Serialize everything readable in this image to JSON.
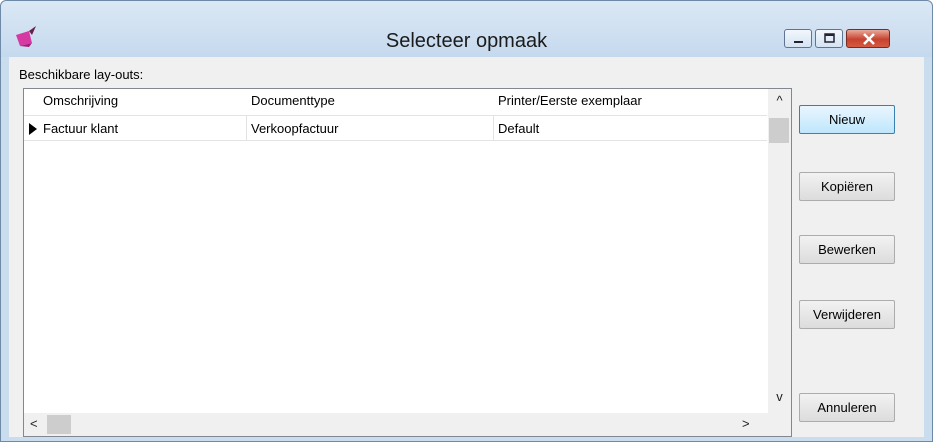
{
  "window": {
    "title": "Selecteer opmaak",
    "controls": [
      "minimize-icon",
      "maximize-icon",
      "close-icon"
    ]
  },
  "layouts_label": "Beschikbare lay-outs:",
  "table": {
    "columns": [
      "Omschrijving",
      "Documenttype",
      "Printer/Eerste exemplaar"
    ],
    "rows": [
      [
        "Factuur klant",
        "Verkoopfactuur",
        "Default"
      ]
    ]
  },
  "scrollbars": {
    "up": "^",
    "down": "v",
    "left": "<",
    "right": ">"
  },
  "buttons": {
    "new": "Nieuw",
    "copy": "Kopiëren",
    "edit": "Bewerken",
    "delete": "Verwijderen",
    "cancel": "Annuleren"
  },
  "colors": {
    "titlebar": "#c9ddef",
    "close_button": "#c7422e",
    "default_button": "#bee6fd",
    "app_icon": "#d63aa2"
  }
}
